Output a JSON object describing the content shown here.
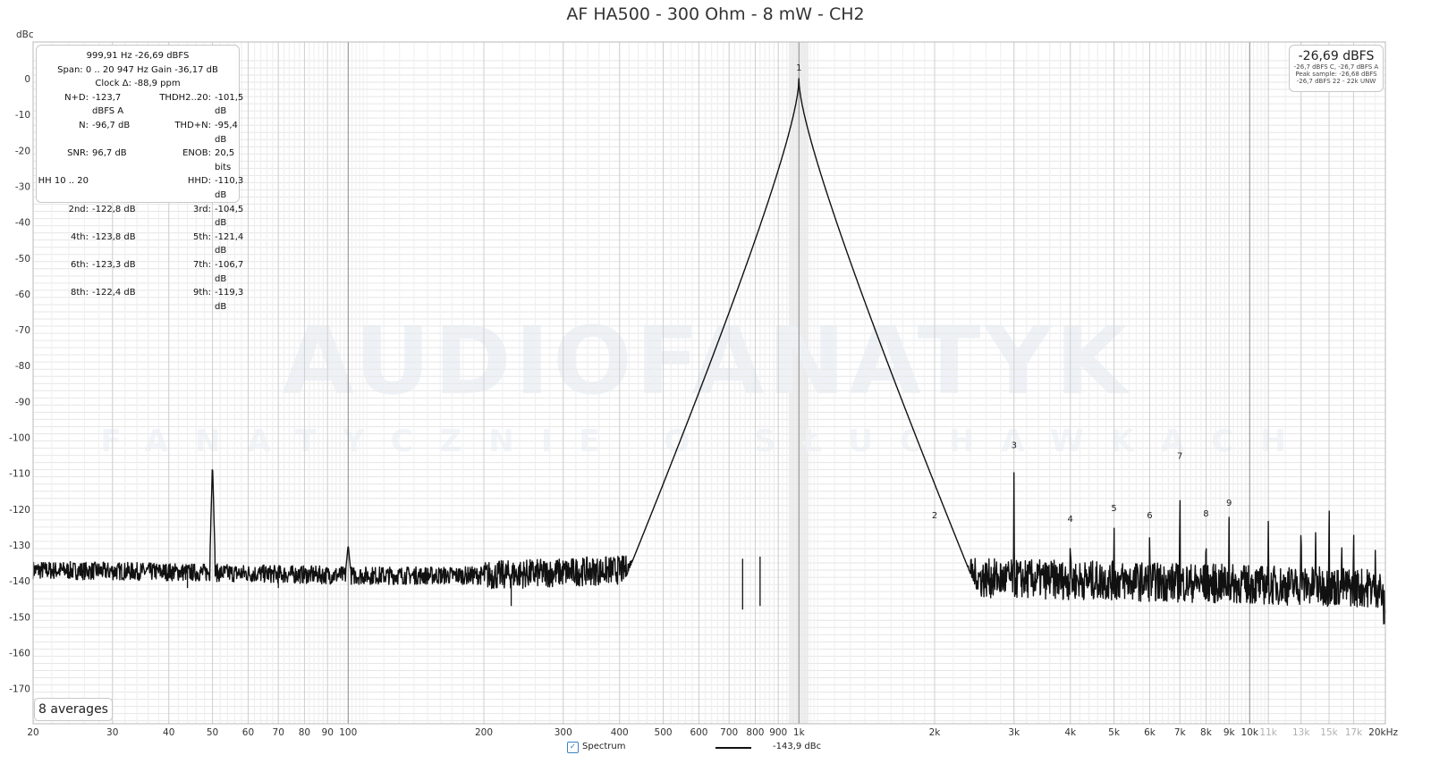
{
  "chart_data": {
    "type": "line",
    "title": "AF HA500 - 300 Ohm - 8 mW - CH2",
    "ylabel": "dBc",
    "xlabel": "",
    "x_scale": "log",
    "xlim": [
      20,
      20000
    ],
    "ylim": [
      -180,
      5
    ],
    "grid": true,
    "y_ticks": [
      0,
      -10,
      -20,
      -30,
      -40,
      -50,
      -60,
      -70,
      -80,
      -90,
      -100,
      -110,
      -120,
      -130,
      -140,
      -150,
      -160,
      -170
    ],
    "y_tick_labels": [
      "0",
      "-10",
      "-20",
      "-30",
      "-40",
      "-50",
      "-60",
      "-70",
      "-80",
      "-90",
      "-100",
      "-110",
      "-120",
      "-130",
      "-140",
      "-150",
      "-160",
      "-170"
    ],
    "x_ticks": [
      {
        "v": 20,
        "label": "20"
      },
      {
        "v": 30,
        "label": "30"
      },
      {
        "v": 40,
        "label": "40"
      },
      {
        "v": 50,
        "label": "50"
      },
      {
        "v": 60,
        "label": "60"
      },
      {
        "v": 70,
        "label": "70"
      },
      {
        "v": 80,
        "label": "80"
      },
      {
        "v": 90,
        "label": "90"
      },
      {
        "v": 100,
        "label": "100"
      },
      {
        "v": 200,
        "label": "200"
      },
      {
        "v": 300,
        "label": "300"
      },
      {
        "v": 400,
        "label": "400"
      },
      {
        "v": 500,
        "label": "500"
      },
      {
        "v": 600,
        "label": "600"
      },
      {
        "v": 700,
        "label": "700"
      },
      {
        "v": 800,
        "label": "800"
      },
      {
        "v": 900,
        "label": "900"
      },
      {
        "v": 1000,
        "label": "1k"
      },
      {
        "v": 2000,
        "label": "2k"
      },
      {
        "v": 3000,
        "label": "3k"
      },
      {
        "v": 4000,
        "label": "4k"
      },
      {
        "v": 5000,
        "label": "5k"
      },
      {
        "v": 6000,
        "label": "6k"
      },
      {
        "v": 7000,
        "label": "7k"
      },
      {
        "v": 8000,
        "label": "8k"
      },
      {
        "v": 9000,
        "label": "9k"
      },
      {
        "v": 10000,
        "label": "10k"
      },
      {
        "v": 11000,
        "label": "11k",
        "faint": true
      },
      {
        "v": 13000,
        "label": "13k",
        "faint": true
      },
      {
        "v": 15000,
        "label": "15k",
        "faint": true
      },
      {
        "v": 17000,
        "label": "17k",
        "faint": true
      },
      {
        "v": 20000,
        "label": "20kHz"
      }
    ],
    "highlight_band": [
      950,
      1050
    ],
    "series": [
      {
        "name": "Spectrum",
        "noise_floor": [
          [
            20,
            -137
          ],
          [
            40,
            -137.5
          ],
          [
            100,
            -138.5
          ],
          [
            200,
            -138.5
          ],
          [
            500,
            -136.5
          ],
          [
            850,
            -133
          ],
          [
            1050,
            -135
          ],
          [
            1500,
            -138
          ],
          [
            2000,
            -139
          ],
          [
            5000,
            -140
          ],
          [
            10000,
            -141
          ],
          [
            19500,
            -142
          ],
          [
            20000,
            -150
          ]
        ],
        "fundamental": {
          "freq": 999.91,
          "value": 0
        },
        "peaks": [
          {
            "freq": 50,
            "value": -107
          },
          {
            "freq": 100,
            "value": -130
          },
          {
            "freq": 2000,
            "value": -124,
            "label": "2"
          },
          {
            "freq": 3000,
            "value": -104.5,
            "label": "3"
          },
          {
            "freq": 4000,
            "value": -125,
            "label": "4"
          },
          {
            "freq": 5000,
            "value": -122,
            "label": "5"
          },
          {
            "freq": 6000,
            "value": -124,
            "label": "6"
          },
          {
            "freq": 7000,
            "value": -107.5,
            "label": "7"
          },
          {
            "freq": 8000,
            "value": -123.5,
            "label": "8"
          },
          {
            "freq": 9000,
            "value": -120.5,
            "label": "9"
          },
          {
            "freq": 11000,
            "value": -122.5
          },
          {
            "freq": 13000,
            "value": -117.5
          },
          {
            "freq": 14000,
            "value": -122.5
          },
          {
            "freq": 15000,
            "value": -113.5
          },
          {
            "freq": 16000,
            "value": -125
          },
          {
            "freq": 17000,
            "value": -122
          },
          {
            "freq": 19000,
            "value": -128.5
          }
        ],
        "dips": [
          [
            230,
            -147
          ],
          [
            750,
            -148
          ],
          [
            820,
            -147
          ],
          [
            70,
            -142
          ],
          [
            44,
            -142
          ]
        ]
      }
    ],
    "fundamental_label": "1"
  },
  "watermark": {
    "line1": "AUDIOFANATYK",
    "line2": "FANATYCZNIE O SŁUCHAWKACH"
  },
  "stats": {
    "line1": "999,91 Hz  -26,69 dBFS",
    "line2": "Span: 0 .. 20 947 Hz   Gain -36,17 dB",
    "line3": "Clock Δ: -88,9 ppm",
    "rows": [
      {
        "l1": "N+D:",
        "v1": "-123,7 dBFS A",
        "l2": "THDH2..20:",
        "v2": "-101,5 dB",
        "wide": true
      },
      {
        "l1": "N:",
        "v1": "-96,7 dB",
        "l2": "THD+N:",
        "v2": "-95,4 dB",
        "wide": true
      },
      {
        "l1": "SNR:",
        "v1": "96,7 dB",
        "l2": "ENOB:",
        "v2": "20,5 bits",
        "wide": true
      },
      {
        "l1": "HH 10 .. 20",
        "v1": "",
        "l2": "HHD:",
        "v2": "-110,3 dB",
        "wide": true
      },
      {
        "l1": "2nd:",
        "v1": "-122,8 dB",
        "l2": "3rd:",
        "v2": "-104,5 dB",
        "wide": true
      },
      {
        "l1": "4th:",
        "v1": "-123,8 dB",
        "l2": "5th:",
        "v2": "-121,4 dB",
        "wide": true
      },
      {
        "l1": "6th:",
        "v1": "-123,3 dB",
        "l2": "7th:",
        "v2": "-106,7 dB",
        "wide": true
      },
      {
        "l1": "8th:",
        "v1": "-122,4 dB",
        "l2": "9th:",
        "v2": "-119,3 dB",
        "wide": true
      }
    ]
  },
  "level": {
    "main": "-26,69 dBFS",
    "sub1": "-26,7 dBFS C, -26,7 dBFS A",
    "sub2": "Peak sample: -26,68 dBFS",
    "sub3": "-26,7 dBFS 22 - 22k UNW"
  },
  "averages": "8 averages",
  "legend": {
    "check": "✓",
    "label": "Spectrum",
    "value": "-143,9 dBc"
  }
}
